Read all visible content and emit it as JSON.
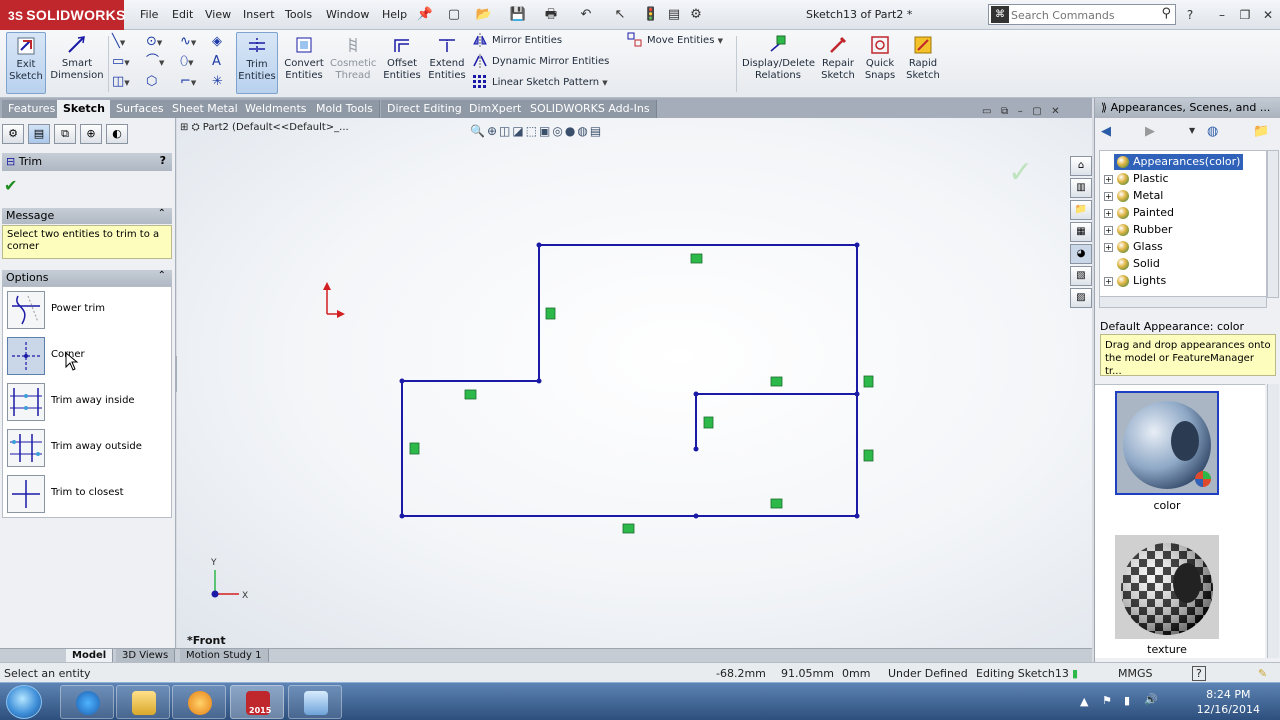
{
  "app": {
    "brand": "SOLIDWORKS",
    "brand_mark": "3S",
    "doc_title": "Sketch13 of Part2 *"
  },
  "menu": [
    "File",
    "Edit",
    "View",
    "Insert",
    "Tools",
    "Window",
    "Help"
  ],
  "search": {
    "placeholder": "Search Commands"
  },
  "ribbon": {
    "exit_sketch": "Exit Sketch",
    "smart_dimension": "Smart Dimension",
    "trim_entities": "Trim Entities",
    "convert_entities": "Convert Entities",
    "cosmetic_thread": "Cosmetic Thread",
    "offset_entities": "Offset Entities",
    "extend_entities": "Extend Entities",
    "mirror_entities": "Mirror Entities",
    "dynamic_mirror": "Dynamic Mirror Entities",
    "linear_pattern": "Linear Sketch Pattern",
    "move_entities": "Move Entities",
    "display_delete": "Display/Delete Relations",
    "repair_sketch": "Repair Sketch",
    "quick_snaps": "Quick Snaps",
    "rapid_sketch": "Rapid Sketch"
  },
  "tabs": [
    {
      "label": "Features",
      "active": false
    },
    {
      "label": "Sketch",
      "active": true
    },
    {
      "label": "Surfaces",
      "active": false
    },
    {
      "label": "Sheet Metal",
      "active": false
    },
    {
      "label": "Weldments",
      "active": false
    },
    {
      "label": "Mold Tools",
      "active": false
    },
    {
      "label": "Direct Editing",
      "active": false
    },
    {
      "label": "DimXpert",
      "active": false
    },
    {
      "label": "SOLIDWORKS Add-Ins",
      "active": false
    }
  ],
  "propertymanager": {
    "title": "Trim",
    "help": "?",
    "message_head": "Message",
    "message": "Select two entities to trim to a corner",
    "options_head": "Options",
    "options": [
      {
        "label": "Power trim",
        "selected": false
      },
      {
        "label": "Corner",
        "selected": true
      },
      {
        "label": "Trim away inside",
        "selected": false
      },
      {
        "label": "Trim away outside",
        "selected": false
      },
      {
        "label": "Trim to closest",
        "selected": false
      }
    ]
  },
  "graphics": {
    "tree_label": "Part2  (Default<<Default>_...",
    "view_name": "*Front",
    "axis_y": "Y",
    "axis_x": "X"
  },
  "rightpane": {
    "title": "Appearances, Scenes, and ...",
    "tree": [
      {
        "label": "Appearances(color)",
        "root": true
      },
      {
        "label": "Plastic"
      },
      {
        "label": "Metal"
      },
      {
        "label": "Painted"
      },
      {
        "label": "Rubber"
      },
      {
        "label": "Glass"
      },
      {
        "label": "Solid"
      },
      {
        "label": "Lights"
      }
    ],
    "default_appearance": "Default Appearance: color",
    "tooltip": "Drag and drop appearances onto the model or FeatureManager tr...",
    "swatches": [
      {
        "label": "color",
        "selected": true
      },
      {
        "label": "texture",
        "selected": false
      }
    ]
  },
  "bottom_tabs": [
    {
      "label": "Model",
      "active": true
    },
    {
      "label": "3D Views",
      "active": false
    },
    {
      "label": "Motion Study 1",
      "active": false
    }
  ],
  "status": {
    "hint": "Select an entity",
    "x": "-68.2mm",
    "y": "91.05mm",
    "z": "0mm",
    "state": "Under Defined",
    "editing": "Editing Sketch13",
    "units": "MMGS",
    "help": "?"
  },
  "taskbar": {
    "time": "8:24 PM",
    "date": "12/16/2014",
    "sw_badge": "2015"
  },
  "colors": {
    "sketch_line": "#1a1aa6",
    "relation_marker": "#2db84a",
    "accent_red": "#c0272d"
  }
}
